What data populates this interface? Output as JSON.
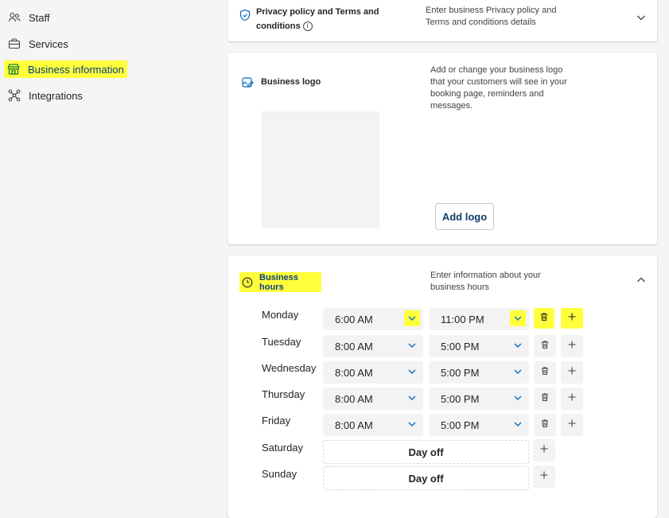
{
  "sidebar": {
    "items": [
      {
        "label": "Staff",
        "icon": "people-icon"
      },
      {
        "label": "Services",
        "icon": "briefcase-icon"
      },
      {
        "label": "Business information",
        "icon": "store-icon",
        "active": true
      },
      {
        "label": "Integrations",
        "icon": "connector-icon"
      }
    ]
  },
  "privacy": {
    "title_line1": "Privacy policy and Terms and",
    "title_line2": "conditions",
    "desc_line1": "Enter business Privacy policy and",
    "desc_line2": "Terms and conditions details"
  },
  "logo_card": {
    "title": "Business logo",
    "desc_lines": [
      "Add or change your business logo",
      "that your customers will see in your",
      "booking page, reminders and",
      "messages."
    ],
    "button": "Add logo"
  },
  "hours": {
    "title": "Business hours",
    "desc_line1": "Enter information about your",
    "desc_line2": "business hours",
    "days": [
      {
        "day": "Monday",
        "start": "6:00 AM",
        "end": "11:00 PM"
      },
      {
        "day": "Tuesday",
        "start": "8:00 AM",
        "end": "5:00 PM"
      },
      {
        "day": "Wednesday",
        "start": "8:00 AM",
        "end": "5:00 PM"
      },
      {
        "day": "Thursday",
        "start": "8:00 AM",
        "end": "5:00 PM"
      },
      {
        "day": "Friday",
        "start": "8:00 AM",
        "end": "5:00 PM"
      },
      {
        "day": "Saturday",
        "off": "Day off"
      },
      {
        "day": "Sunday",
        "off": "Day off"
      }
    ]
  },
  "colors": {
    "highlight": "#ffff3c",
    "accent": "#0f6cbd"
  }
}
